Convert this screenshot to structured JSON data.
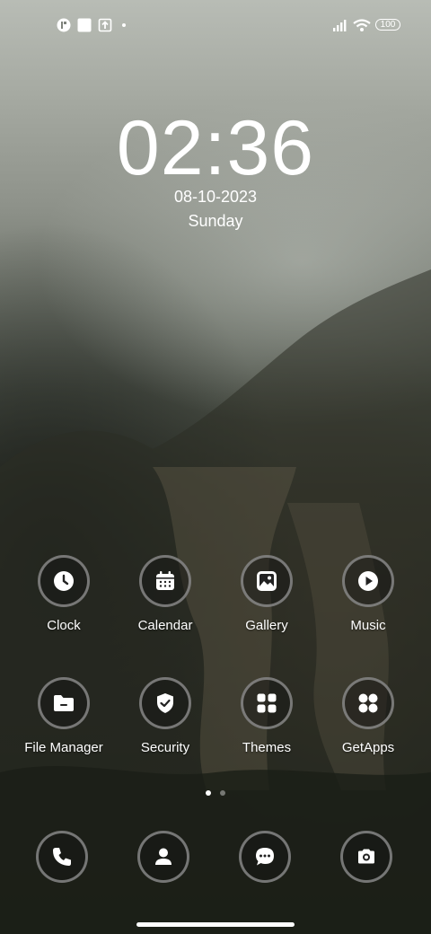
{
  "status_bar": {
    "battery_level": "100",
    "icons": [
      "notification-icon",
      "square-icon",
      "upload-icon",
      "dot-icon",
      "signal-icon",
      "wifi-icon",
      "battery-icon"
    ]
  },
  "lockclock": {
    "time": "02:36",
    "date": "08-10-2023",
    "day": "Sunday"
  },
  "apps": [
    {
      "label": "Clock",
      "icon": "clock-icon"
    },
    {
      "label": "Calendar",
      "icon": "calendar-icon"
    },
    {
      "label": "Gallery",
      "icon": "gallery-icon"
    },
    {
      "label": "Music",
      "icon": "music-icon"
    },
    {
      "label": "File Manager",
      "icon": "folder-icon"
    },
    {
      "label": "Security",
      "icon": "shield-icon"
    },
    {
      "label": "Themes",
      "icon": "themes-icon"
    },
    {
      "label": "GetApps",
      "icon": "getapps-icon"
    }
  ],
  "dock": [
    {
      "icon": "phone-icon"
    },
    {
      "icon": "contacts-icon"
    },
    {
      "icon": "messages-icon"
    },
    {
      "icon": "camera-icon"
    }
  ],
  "pager": {
    "pages": 2,
    "current": 1
  },
  "colors": {
    "icon_ring": "#969696",
    "text": "#ffffff"
  }
}
